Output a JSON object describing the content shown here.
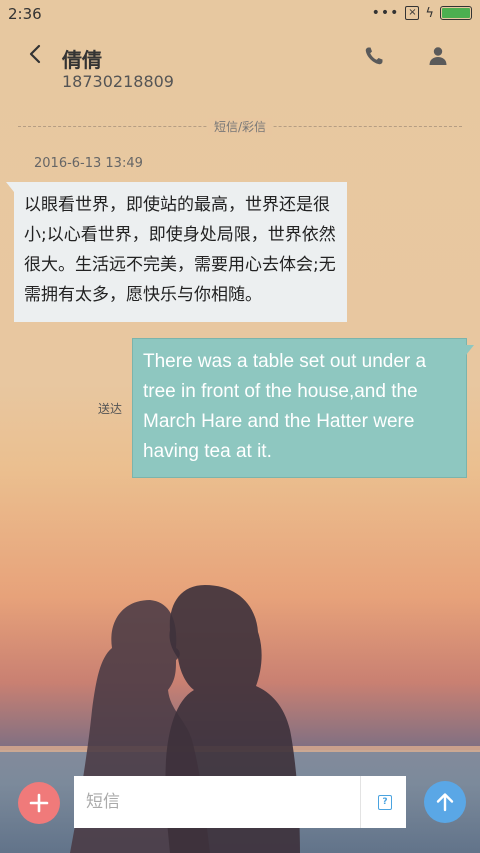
{
  "status_bar": {
    "time": "2:36",
    "dots": "•••"
  },
  "header": {
    "contact_name": "倩倩",
    "contact_number": "18730218809",
    "back_icon": "chevron-left-icon",
    "call_icon": "phone-icon",
    "profile_icon": "person-icon"
  },
  "thread": {
    "channel_label": "短信/彩信",
    "timestamp": "2016-6-13 13:49",
    "messages": [
      {
        "direction": "incoming",
        "text": "以眼看世界，即使站的最高，世界还是很小;以心看世界，即使身处局限，世界依然很大。生活远不完美，需要用心去体会;无需拥有太多，愿快乐与你相随。"
      },
      {
        "direction": "outgoing",
        "text": "There was a table set out under a tree in front of the house,and the March Hare and the Hatter were having tea at it.",
        "status": "送达"
      }
    ]
  },
  "composer": {
    "placeholder": "短信",
    "value": "",
    "add_icon": "plus-icon",
    "sms_icon": "sms-indicator-icon",
    "send_icon": "arrow-up-icon"
  },
  "colors": {
    "incoming_bubble": "#eceff0",
    "outgoing_bubble": "#8ec7c0",
    "add_button": "#f07a7a",
    "send_button": "#5aa7e6",
    "battery": "#4caf50"
  }
}
